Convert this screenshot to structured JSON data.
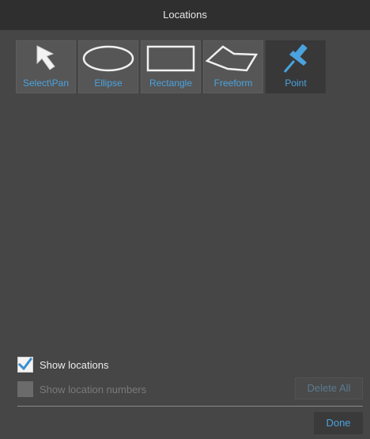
{
  "dialog": {
    "title": "Locations"
  },
  "tools": [
    {
      "label": "Select\\Pan",
      "icon": "arrow-cursor-icon",
      "selected": false
    },
    {
      "label": "Ellipse",
      "icon": "ellipse-icon",
      "selected": false
    },
    {
      "label": "Rectangle",
      "icon": "rectangle-icon",
      "selected": false
    },
    {
      "label": "Freeform",
      "icon": "freeform-polygon-icon",
      "selected": false
    },
    {
      "label": "Point",
      "icon": "pushpin-icon",
      "selected": true
    }
  ],
  "options": {
    "show_locations": {
      "label": "Show locations",
      "checked": true,
      "enabled": true
    },
    "show_location_numbers": {
      "label": "Show location numbers",
      "checked": false,
      "enabled": false
    }
  },
  "buttons": {
    "delete_all": "Delete All",
    "done": "Done"
  },
  "colors": {
    "accent": "#4aa3df",
    "background": "#464646",
    "titlebar": "#2f2f2f"
  }
}
